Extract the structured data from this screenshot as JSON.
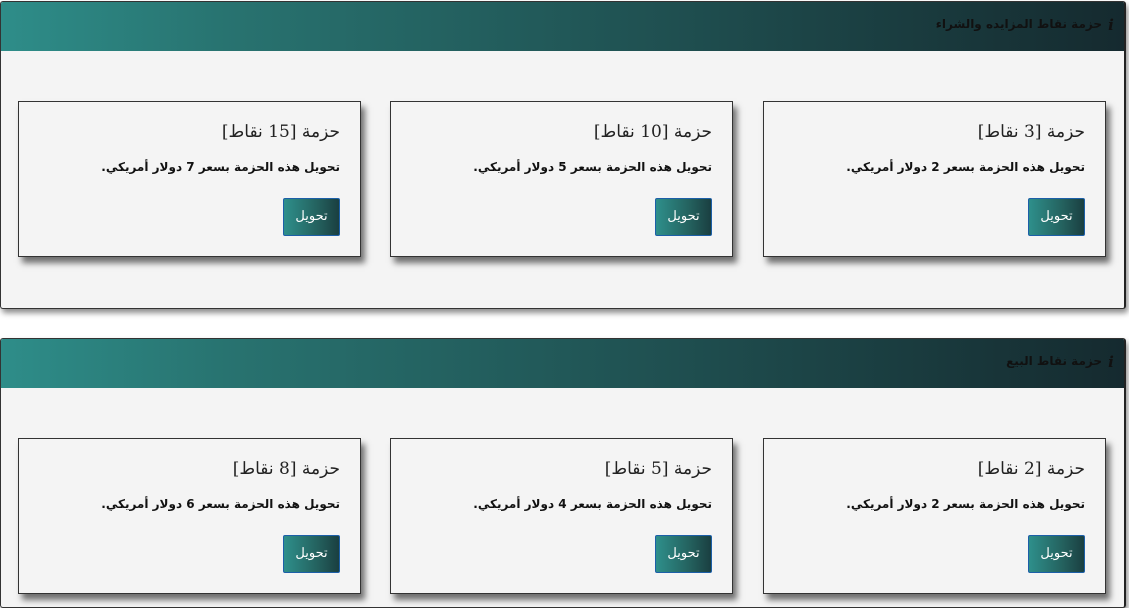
{
  "sections": [
    {
      "title": "حزمة نقاط المزايده والشراء",
      "cards": [
        {
          "title": "حزمة [3 نقاط]",
          "description": "تحويل هذه الحزمة بسعر 2 دولار أمريكي.",
          "button_label": "تحويل"
        },
        {
          "title": "حزمة [10 نقاط]",
          "description": "تحويل هذه الحزمة بسعر 5 دولار أمريكي.",
          "button_label": "تحويل"
        },
        {
          "title": "حزمة [15 نقاط]",
          "description": "تحويل هذه الحزمة بسعر 7 دولار أمريكي.",
          "button_label": "تحويل"
        }
      ]
    },
    {
      "title": "حزمة نقاط البيع",
      "cards": [
        {
          "title": "حزمة [2 نقاط]",
          "description": "تحويل هذه الحزمة بسعر 2 دولار أمريكي.",
          "button_label": "تحويل"
        },
        {
          "title": "حزمة [5 نقاط]",
          "description": "تحويل هذه الحزمة بسعر 4 دولار أمريكي.",
          "button_label": "تحويل"
        },
        {
          "title": "حزمة [8 نقاط]",
          "description": "تحويل هذه الحزمة بسعر 6 دولار أمريكي.",
          "button_label": "تحويل"
        }
      ]
    }
  ],
  "icons": {
    "section_header": "info-icon"
  },
  "colors": {
    "header_gradient_start": "#2e8d89",
    "header_gradient_end": "#152a2f",
    "button_border": "#1c5fa8",
    "panel_background": "#f4f4f4"
  }
}
